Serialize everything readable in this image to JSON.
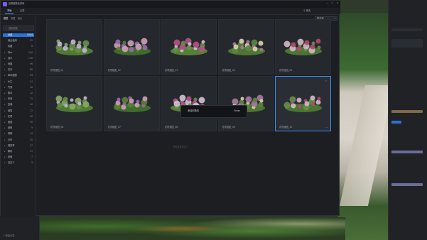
{
  "app": {
    "title": "景观植物素材库"
  },
  "window_controls": [
    "—",
    "□",
    "×"
  ],
  "tabs": [
    {
      "label": "本地",
      "active": true
    },
    {
      "label": "云端",
      "active": false
    }
  ],
  "toolbar": {
    "filter_label": "筛选",
    "sort_value": "按名称"
  },
  "sidebar": {
    "tabs": [
      "模型",
      "收藏",
      "最近"
    ],
    "search_placeholder": "搜索植物",
    "categories": [
      {
        "label": "全部",
        "count": "1024",
        "active": true
      },
      {
        "label": "最近使用",
        "count": "32"
      },
      {
        "label": "收藏",
        "count": "8"
      },
      {
        "label": "乔木",
        "count": "216"
      },
      {
        "label": "灌木",
        "count": "148"
      },
      {
        "label": "地被",
        "count": "96"
      },
      {
        "label": "花卉",
        "count": "88"
      },
      {
        "label": "草本植物",
        "count": "64"
      },
      {
        "label": "水生",
        "count": "24"
      },
      {
        "label": "竹类",
        "count": "18"
      },
      {
        "label": "藤本",
        "count": "22"
      },
      {
        "label": "多肉",
        "count": "15"
      },
      {
        "label": "盆栽",
        "count": "40"
      },
      {
        "label": "绿篱",
        "count": "12"
      },
      {
        "label": "花境",
        "count": "56"
      },
      {
        "label": "组团",
        "count": "30"
      },
      {
        "label": "造型",
        "count": "9"
      },
      {
        "label": "棕榈",
        "count": "14"
      },
      {
        "label": "针叶",
        "count": "20"
      },
      {
        "label": "观赏草",
        "count": "27"
      },
      {
        "label": "果树",
        "count": "11"
      },
      {
        "label": "其他",
        "count": "7"
      },
      {
        "label": "自定义",
        "count": "3"
      }
    ],
    "bottom_add": "+ 新建分类"
  },
  "grid": {
    "items": [
      {
        "name": "花境组团_01"
      },
      {
        "name": "花境组团_02"
      },
      {
        "name": "花境组团_03"
      },
      {
        "name": "花境组团_04"
      },
      {
        "name": "花境组团_05"
      },
      {
        "name": "花境组团_06"
      },
      {
        "name": "花境组团_07"
      },
      {
        "name": "花境组团_08"
      },
      {
        "name": "花境组团_09"
      },
      {
        "name": "花境组团_10",
        "selected": true
      }
    ]
  },
  "empty_hint": "没有更多内容了",
  "tooltip": {
    "label": "添加到场景",
    "value": "Enter"
  },
  "colors": {
    "accent": "#3b8ff0",
    "brand": "#7b5cff"
  }
}
